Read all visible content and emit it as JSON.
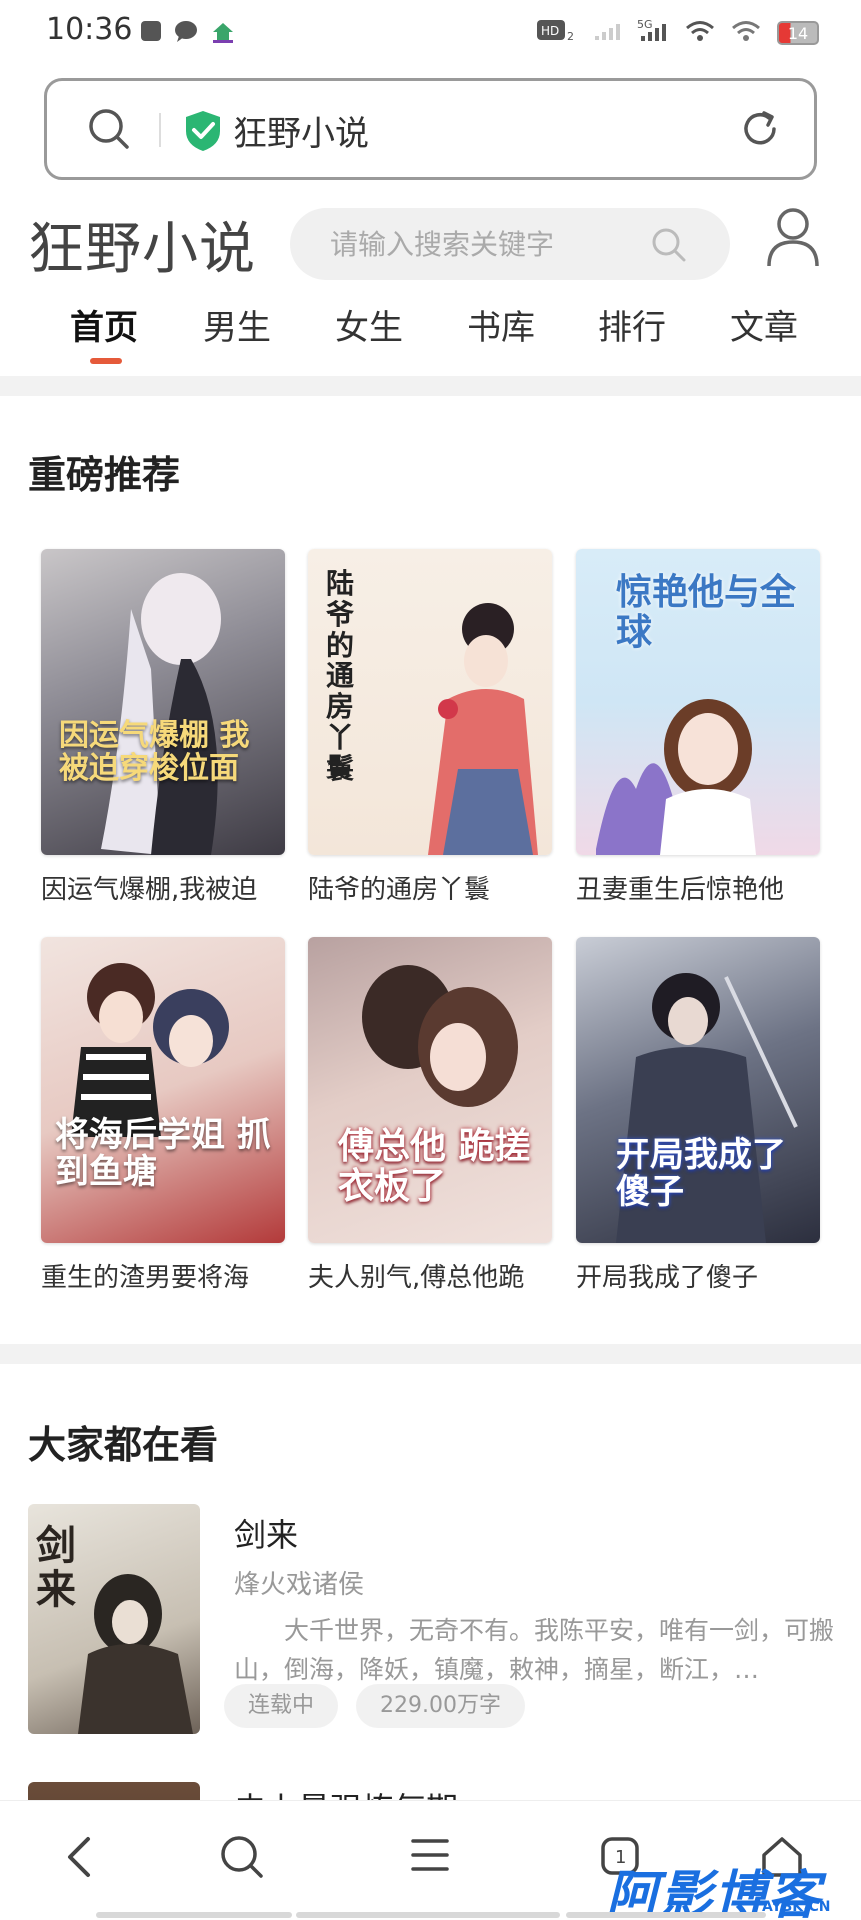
{
  "status_bar": {
    "time": "10:36",
    "battery": "14"
  },
  "address_bar": {
    "text": "狂野小说"
  },
  "site": {
    "logo": "狂野小说",
    "search_placeholder": "请输入搜索关键字",
    "tabs": [
      {
        "label": "首页",
        "active": true
      },
      {
        "label": "男生"
      },
      {
        "label": "女生"
      },
      {
        "label": "书库"
      },
      {
        "label": "排行"
      },
      {
        "label": "文章"
      }
    ]
  },
  "featured": {
    "title": "重磅推荐",
    "books": [
      {
        "title": "因运气爆棚,我被迫",
        "cover_text": "因运气爆棚 我被迫穿梭位面"
      },
      {
        "title": "陆爷的通房丫鬟",
        "cover_text": "陆爷的通房丫鬟"
      },
      {
        "title": "丑妻重生后惊艳他",
        "cover_text": "惊艳他与全球"
      },
      {
        "title": "重生的渣男要将海",
        "cover_text": "将海后学姐 抓到鱼塘"
      },
      {
        "title": "夫人别气,傅总他跪",
        "cover_text": "傅总他 跪搓衣板了"
      },
      {
        "title": "开局我成了傻子",
        "cover_text": "开局我成了傻子"
      }
    ]
  },
  "popular": {
    "title": "大家都在看",
    "items": [
      {
        "title": "剑来",
        "author": "烽火戏诸侯",
        "description": "大千世界，无奇不有。我陈平安，唯有一剑，可搬山，倒海，降妖，镇魔，敕神，摘星，断江，…",
        "status": "连载中",
        "words": "229.00万字",
        "cover_text": "剑来"
      },
      {
        "title": "史上最强炼气期"
      }
    ]
  },
  "watermark": {
    "main": "阿影博客",
    "sub": "AYBK.CN"
  }
}
